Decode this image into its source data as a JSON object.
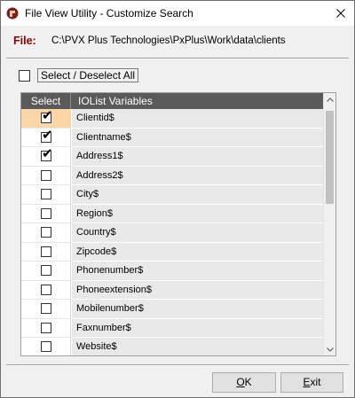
{
  "window": {
    "title": "File View Utility - Customize Search",
    "close_icon": "close-icon",
    "app_icon": "pvx-app-icon"
  },
  "file": {
    "label": "File:",
    "path": "C:\\PVX Plus Technologies\\PxPlus\\Work\\data\\clients"
  },
  "select_all": {
    "label": "Select / Deselect All",
    "checked": false
  },
  "grid": {
    "columns": [
      "Select",
      "IOList Variables"
    ],
    "rows": [
      {
        "name": "Clientid$",
        "checked": true,
        "active": true
      },
      {
        "name": "Clientname$",
        "checked": true,
        "active": false
      },
      {
        "name": "Address1$",
        "checked": true,
        "active": false
      },
      {
        "name": "Address2$",
        "checked": false,
        "active": false
      },
      {
        "name": "City$",
        "checked": false,
        "active": false
      },
      {
        "name": "Region$",
        "checked": false,
        "active": false
      },
      {
        "name": "Country$",
        "checked": false,
        "active": false
      },
      {
        "name": "Zipcode$",
        "checked": false,
        "active": false
      },
      {
        "name": "Phonenumber$",
        "checked": false,
        "active": false
      },
      {
        "name": "Phoneextension$",
        "checked": false,
        "active": false
      },
      {
        "name": "Mobilenumber$",
        "checked": false,
        "active": false
      },
      {
        "name": "Faxnumber$",
        "checked": false,
        "active": false
      },
      {
        "name": "Website$",
        "checked": false,
        "active": false
      }
    ]
  },
  "buttons": {
    "ok_label": "OK",
    "exit_label": "Exit"
  },
  "colors": {
    "file_label": "#8b0000",
    "header_bg": "#5a5a5a",
    "active_row": "#fbd6a7",
    "cell_bg": "#e9e9e9"
  }
}
